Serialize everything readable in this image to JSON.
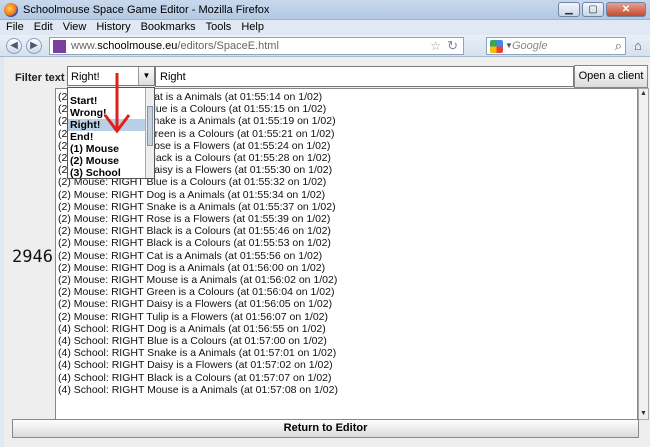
{
  "window": {
    "title": "Schoolmouse Space Game Editor - Mozilla Firefox"
  },
  "menu": [
    "File",
    "Edit",
    "View",
    "History",
    "Bookmarks",
    "Tools",
    "Help"
  ],
  "nav": {
    "url_prefix": "www.",
    "url_host": "schoolmouse.eu",
    "url_path": "/editors/SpaceE.html",
    "search_placeholder": "Google"
  },
  "filter": {
    "label": "Filter text by:",
    "selected": "Right!",
    "input_value": "Right",
    "open_button": "Open a client"
  },
  "dropdown_options": [
    "Start!",
    "Wrong!",
    "Right!",
    "End!",
    "(1) Mouse",
    "(2) Mouse",
    "(3) School"
  ],
  "dropdown_selected_index": 2,
  "count": "2946",
  "log_lines": [
    "(2) Mouse: RIGHT Cat is a Animals (at 01:55:14 on  1/02)",
    "(2) Mouse: RIGHT Blue is a Colours (at 01:55:15 on  1/02)",
    "(2) Mouse: RIGHT Snake is a Animals (at 01:55:19 on  1/02)",
    "(2) Mouse: RIGHT Green is a Colours (at 01:55:21 on  1/02)",
    "(2) Mouse: RIGHT Rose is a Flowers (at 01:55:24 on  1/02)",
    "(2) Mouse: RIGHT Black is a Colours (at 01:55:28 on  1/02)",
    "(2) Mouse: RIGHT Daisy is a Flowers (at 01:55:30 on  1/02)",
    "(2) Mouse: RIGHT Blue is a Colours (at 01:55:32 on  1/02)",
    "(2) Mouse: RIGHT Dog is a Animals (at 01:55:34 on  1/02)",
    "(2) Mouse: RIGHT Snake is a Animals (at 01:55:37 on  1/02)",
    "(2) Mouse: RIGHT Rose is a Flowers (at 01:55:39 on  1/02)",
    "(2) Mouse: RIGHT Black is a Colours (at 01:55:46 on  1/02)",
    "(2) Mouse: RIGHT Black is a Colours (at 01:55:53 on  1/02)",
    "(2) Mouse: RIGHT Cat is a Animals (at 01:55:56 on  1/02)",
    "(2) Mouse: RIGHT Dog is a Animals (at 01:56:00 on  1/02)",
    "(2) Mouse: RIGHT Mouse is a Animals (at 01:56:02 on  1/02)",
    "(2) Mouse: RIGHT Green is a Colours (at 01:56:04 on  1/02)",
    "(2) Mouse: RIGHT Daisy is a Flowers (at 01:56:05 on  1/02)",
    "(2) Mouse: RIGHT Tulip is a Flowers (at 01:56:07 on  1/02)",
    "(4) School: RIGHT Dog is a Animals (at 01:56:55 on  1/02)",
    "(4) School: RIGHT Blue is a Colours (at 01:57:00 on  1/02)",
    "(4) School: RIGHT Snake is a Animals (at 01:57:01 on  1/02)",
    "(4) School: RIGHT Daisy is a Flowers (at 01:57:02 on  1/02)",
    "(4) School: RIGHT Black is a Colours (at 01:57:07 on  1/02)",
    "(4) School: RIGHT Mouse is a Animals (at 01:57:08 on  1/02)"
  ],
  "return_button": "Return to Editor",
  "icons": {
    "back": "back-arrow-icon",
    "forward": "forward-arrow-icon",
    "bookmark": "star-icon",
    "reload": "reload-icon",
    "search_go": "magnifier-icon",
    "home": "home-icon"
  },
  "colors": {
    "selection": "#b8cfe5",
    "annotation_arrow": "#e0201a"
  }
}
